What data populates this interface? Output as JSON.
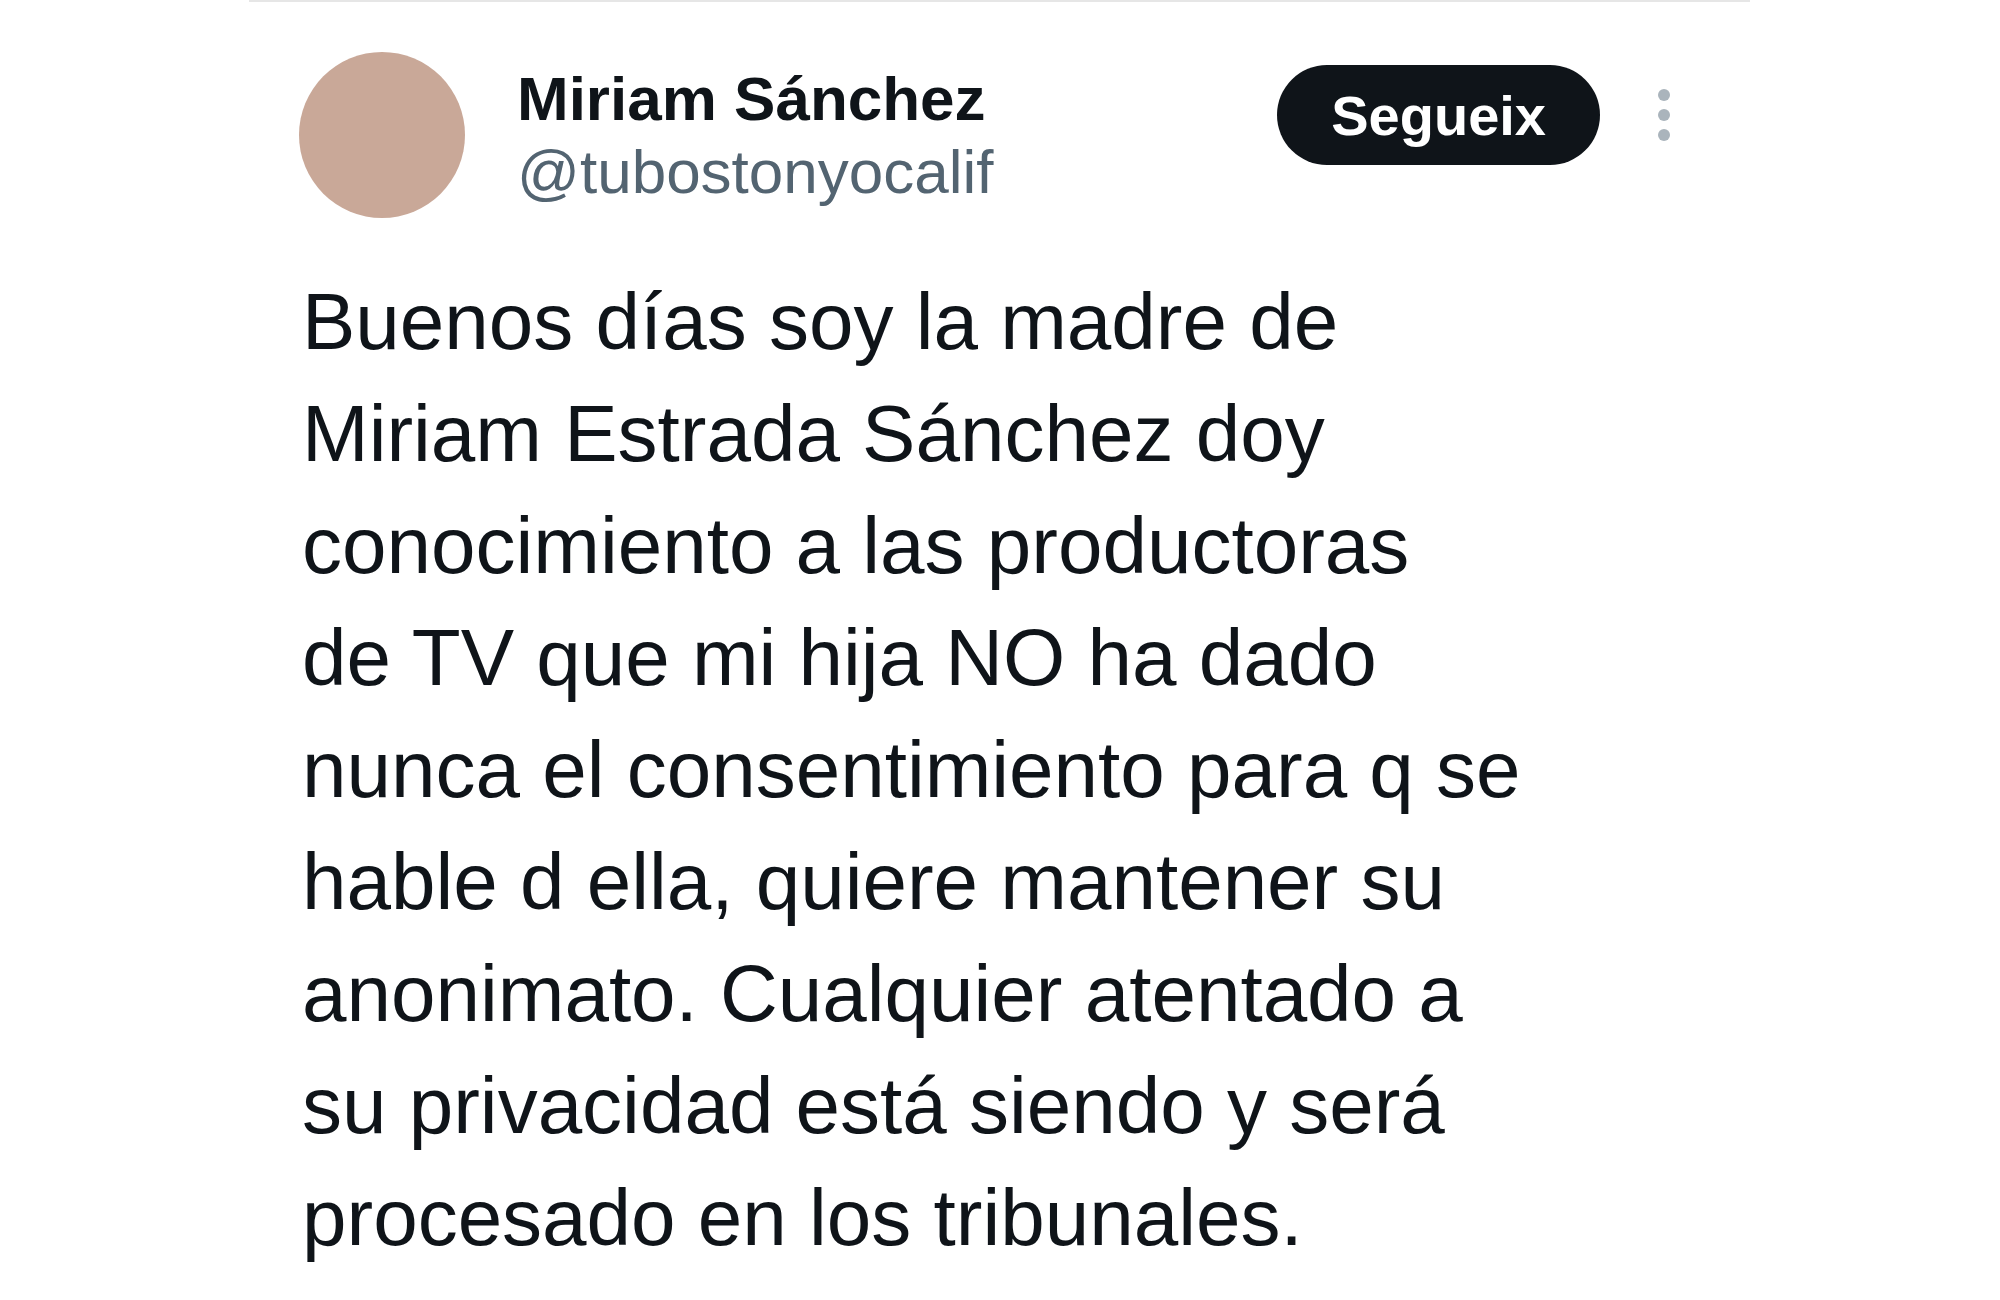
{
  "post": {
    "author": {
      "name": "Miriam Sánchez",
      "handle": "@tubostonyocalif"
    },
    "follow_button": {
      "label": "Segueix"
    },
    "text": "Buenos días soy la madre de\nMiriam Estrada Sánchez doy\nconocimiento a las productoras\nde TV que mi hija NO ha dado\nnunca el consentimiento para q se\nhable d ella, quiere mantener su\nanonimato. Cualquier atentado a\nsu privacidad está siendo y será\nprocesado en los tribunales."
  }
}
